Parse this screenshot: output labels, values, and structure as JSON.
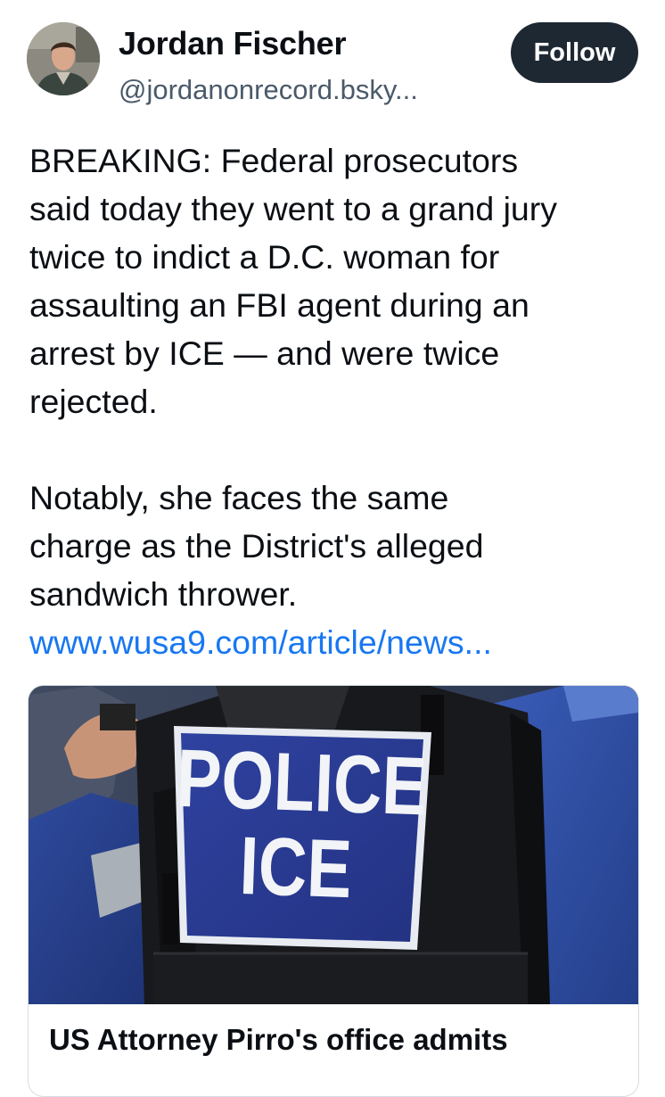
{
  "author": {
    "name": "Jordan Fischer",
    "handle": "@jordanonrecord.bsky...",
    "avatar_icon": "profile-photo"
  },
  "follow_button": {
    "label": "Follow"
  },
  "post": {
    "paragraph1_lines": [
      "BREAKING: Federal prosecutors",
      "said today they went to a grand jury",
      "twice to indict a D.C. woman for",
      "assaulting an FBI agent during an",
      "arrest by ICE — and were twice",
      "rejected."
    ],
    "paragraph2_lines": [
      "Notably, she faces the same",
      "charge as the District's alleged",
      "sandwich thrower."
    ],
    "link_text": "www.wusa9.com/article/news..."
  },
  "link_card": {
    "image": {
      "vest_patch_line1": "POLICE",
      "vest_patch_line2": "ICE"
    },
    "title": "US Attorney Pirro's office admits"
  },
  "colors": {
    "follow_button_bg": "#1e2833",
    "link": "#1877f2",
    "patch_blue": "#2c3d96"
  }
}
